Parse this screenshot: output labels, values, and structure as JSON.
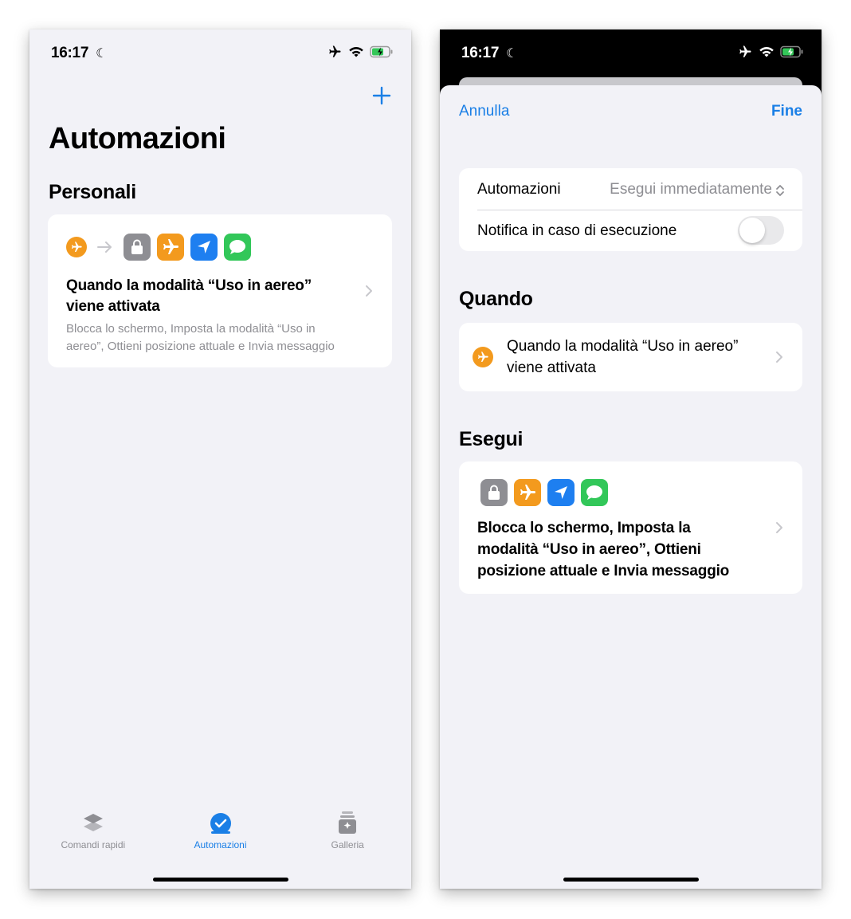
{
  "left": {
    "status": {
      "time": "16:17"
    },
    "title": "Automazioni",
    "section": "Personali",
    "automation": {
      "title": "Quando la modalità “Uso in aereo” viene attivata",
      "title_line1": "Quando la modalità “Uso in aereo”",
      "title_line2": "viene attivata",
      "subtitle_line1": "Blocca lo schermo, Imposta la modalità “Uso in",
      "subtitle_line2": "aereo”, Ottieni posizione attuale e Invia messaggio"
    },
    "tabs": [
      {
        "label": "Comandi rapidi",
        "icon": "layers-icon",
        "active": false
      },
      {
        "label": "Automazioni",
        "icon": "automation-check-icon",
        "active": true
      },
      {
        "label": "Galleria",
        "icon": "gallery-icon",
        "active": false
      }
    ]
  },
  "right": {
    "status": {
      "time": "16:17"
    },
    "nav": {
      "cancel": "Annulla",
      "done": "Fine"
    },
    "settings": {
      "automation_label": "Automazioni",
      "automation_value": "Esegui immediatamente",
      "notify_label": "Notifica in caso di esecuzione",
      "notify_on": false
    },
    "when_section": "Quando",
    "trigger_line1": "Quando la modalità “Uso in aereo”",
    "trigger_line2": "viene attivata",
    "run_section": "Esegui",
    "actions_line1": "Blocca lo schermo, Imposta la",
    "actions_line2": "modalità “Uso in aereo”, Ottieni",
    "actions_line3": "posizione attuale e Invia messaggio"
  },
  "colors": {
    "accent": "#1a7fe6",
    "orange": "#f39a1e",
    "gray_tile": "#8e8e93",
    "blue_tile": "#1e7ff0",
    "green_tile": "#32c759",
    "background": "#f2f2f7"
  }
}
